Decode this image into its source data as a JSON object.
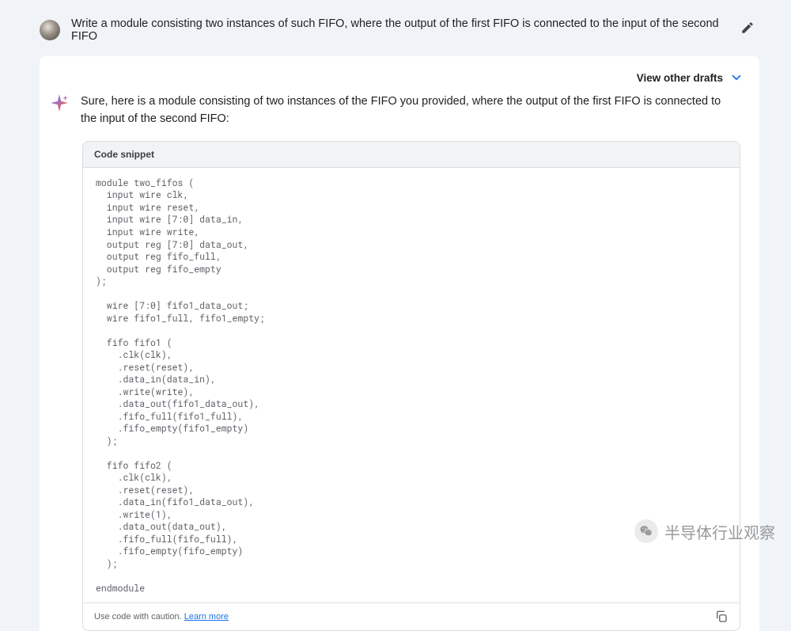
{
  "user": {
    "prompt": "Write a module consisting two instances of such FIFO, where the output of the first FIFO is connected to the input of the second FIFO"
  },
  "drafts": {
    "label": "View other drafts"
  },
  "response": {
    "intro": "Sure, here is a module consisting of two instances of the FIFO you provided, where the output of the first FIFO is connected to the input of the second FIFO:"
  },
  "code": {
    "header": "Code snippet",
    "body": "module two_fifos (\n  input wire clk,\n  input wire reset,\n  input wire [7:0] data_in,\n  input wire write,\n  output reg [7:0] data_out,\n  output reg fifo_full,\n  output reg fifo_empty\n);\n\n  wire [7:0] fifo1_data_out;\n  wire fifo1_full, fifo1_empty;\n\n  fifo fifo1 (\n    .clk(clk),\n    .reset(reset),\n    .data_in(data_in),\n    .write(write),\n    .data_out(fifo1_data_out),\n    .fifo_full(fifo1_full),\n    .fifo_empty(fifo1_empty)\n  );\n\n  fifo fifo2 (\n    .clk(clk),\n    .reset(reset),\n    .data_in(fifo1_data_out),\n    .write(1),\n    .data_out(data_out),\n    .fifo_full(fifo_full),\n    .fifo_empty(fifo_empty)\n  );\n\nendmodule",
    "caution_prefix": "Use code with caution. ",
    "learn_more": "Learn more"
  },
  "watermark": {
    "text": "半导体行业观察"
  }
}
